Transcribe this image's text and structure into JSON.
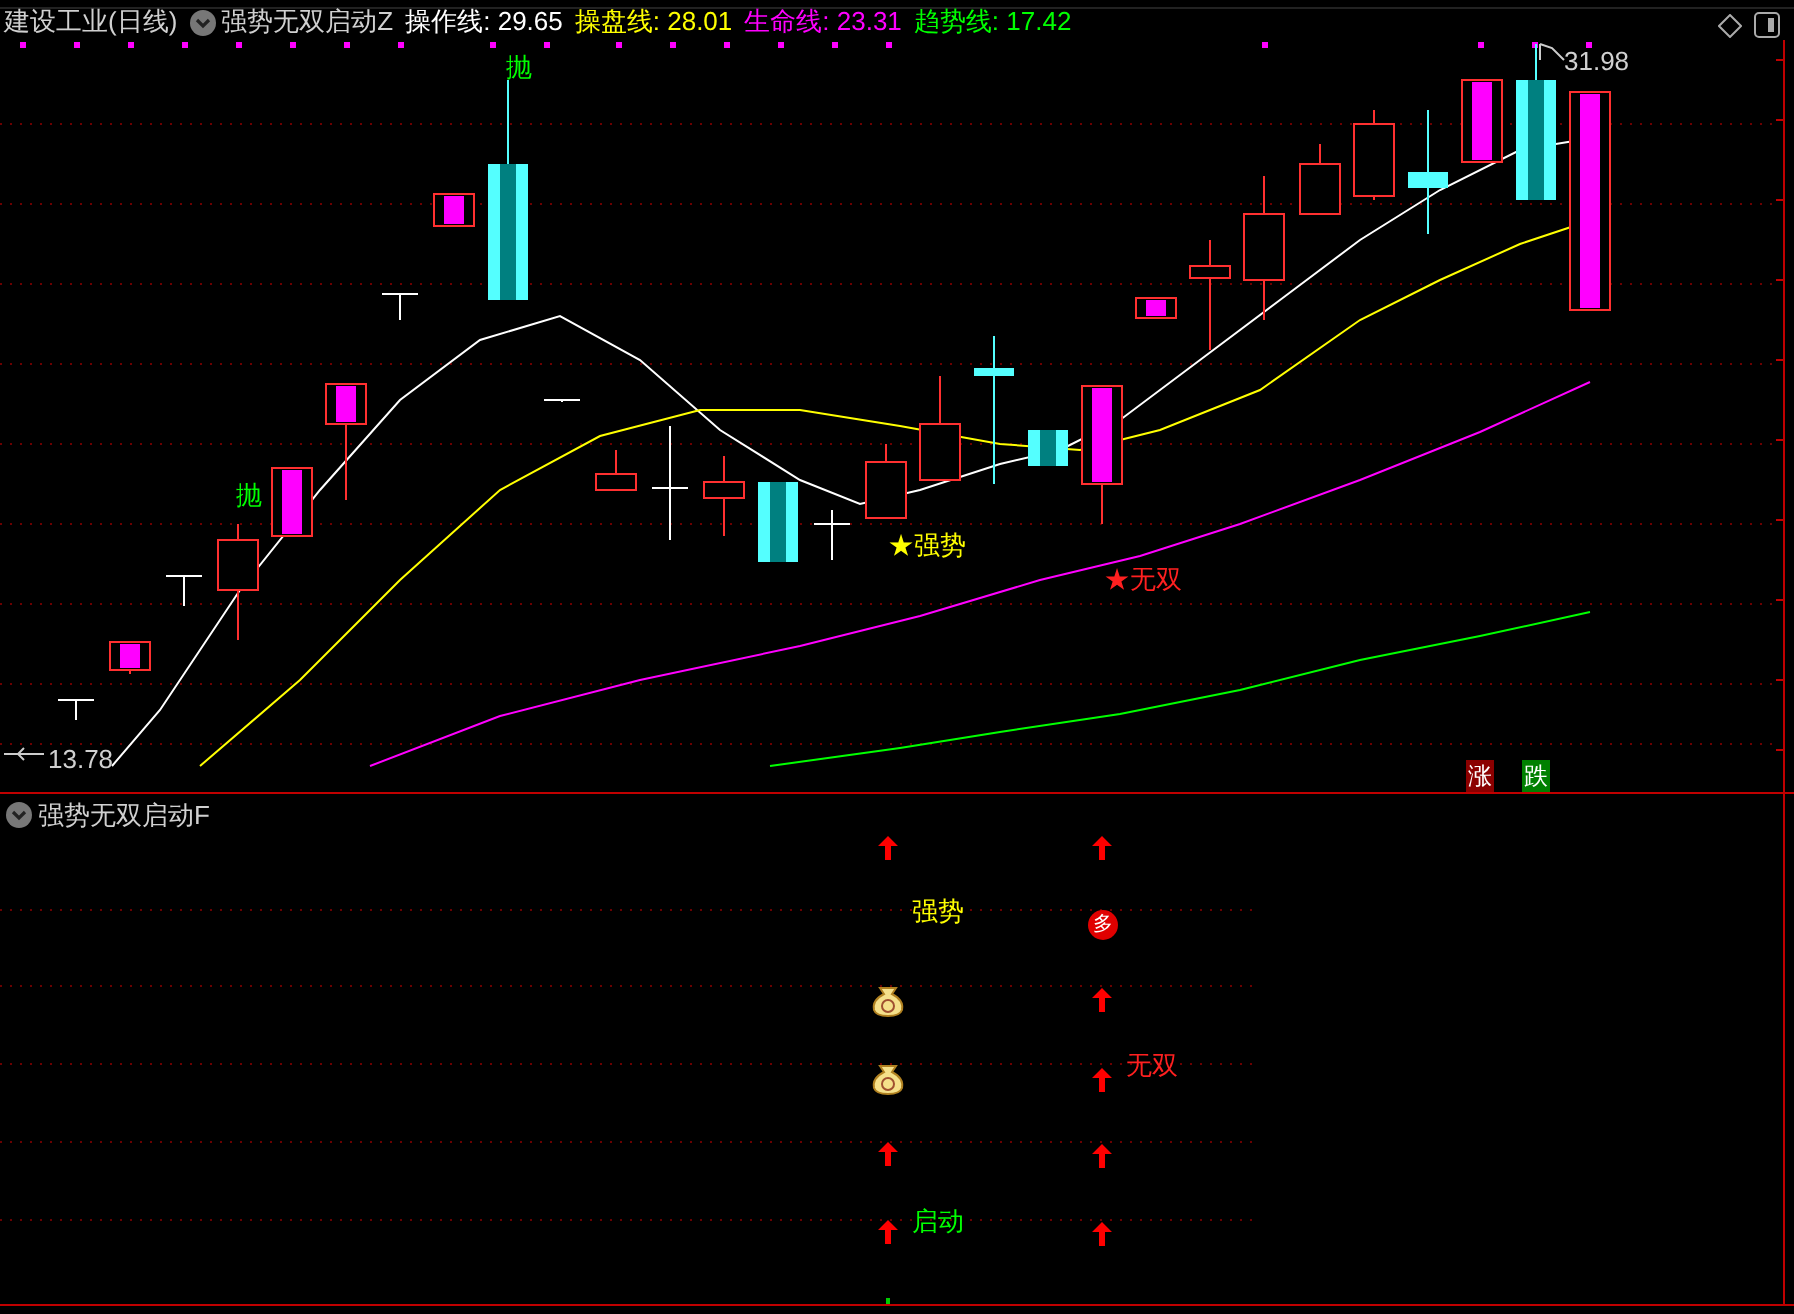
{
  "header": {
    "stock": "建设工业(日线)",
    "indicator": "强势无双启动Z",
    "lines": [
      {
        "label": "操作线: 29.65",
        "color": "#ffffff"
      },
      {
        "label": "操盘线: 28.01",
        "color": "#ffff00"
      },
      {
        "label": "生命线: 23.31",
        "color": "#ff00ff"
      },
      {
        "label": "趋势线: 17.42",
        "color": "#00ff00"
      }
    ]
  },
  "main_chart": {
    "high_label": "31.98",
    "low_label": "13.78",
    "signals": [
      {
        "text": "抛",
        "color": "#00ff00"
      },
      {
        "text": "抛",
        "color": "#00ff00"
      },
      {
        "text": "★强势",
        "color": "#ffff00"
      },
      {
        "text": "★无双",
        "color": "#ff2020"
      }
    ],
    "badges": [
      {
        "text": "涨",
        "color": "#8b0000"
      },
      {
        "text": "跌",
        "color": "#008000"
      }
    ]
  },
  "sub_panel": {
    "title": "强势无双启动F",
    "labels": [
      {
        "text": "强势",
        "color": "#ffff00"
      },
      {
        "text": "无双",
        "color": "#ff2020"
      },
      {
        "text": "启动",
        "color": "#00ff00"
      }
    ],
    "badge": "多"
  }
}
